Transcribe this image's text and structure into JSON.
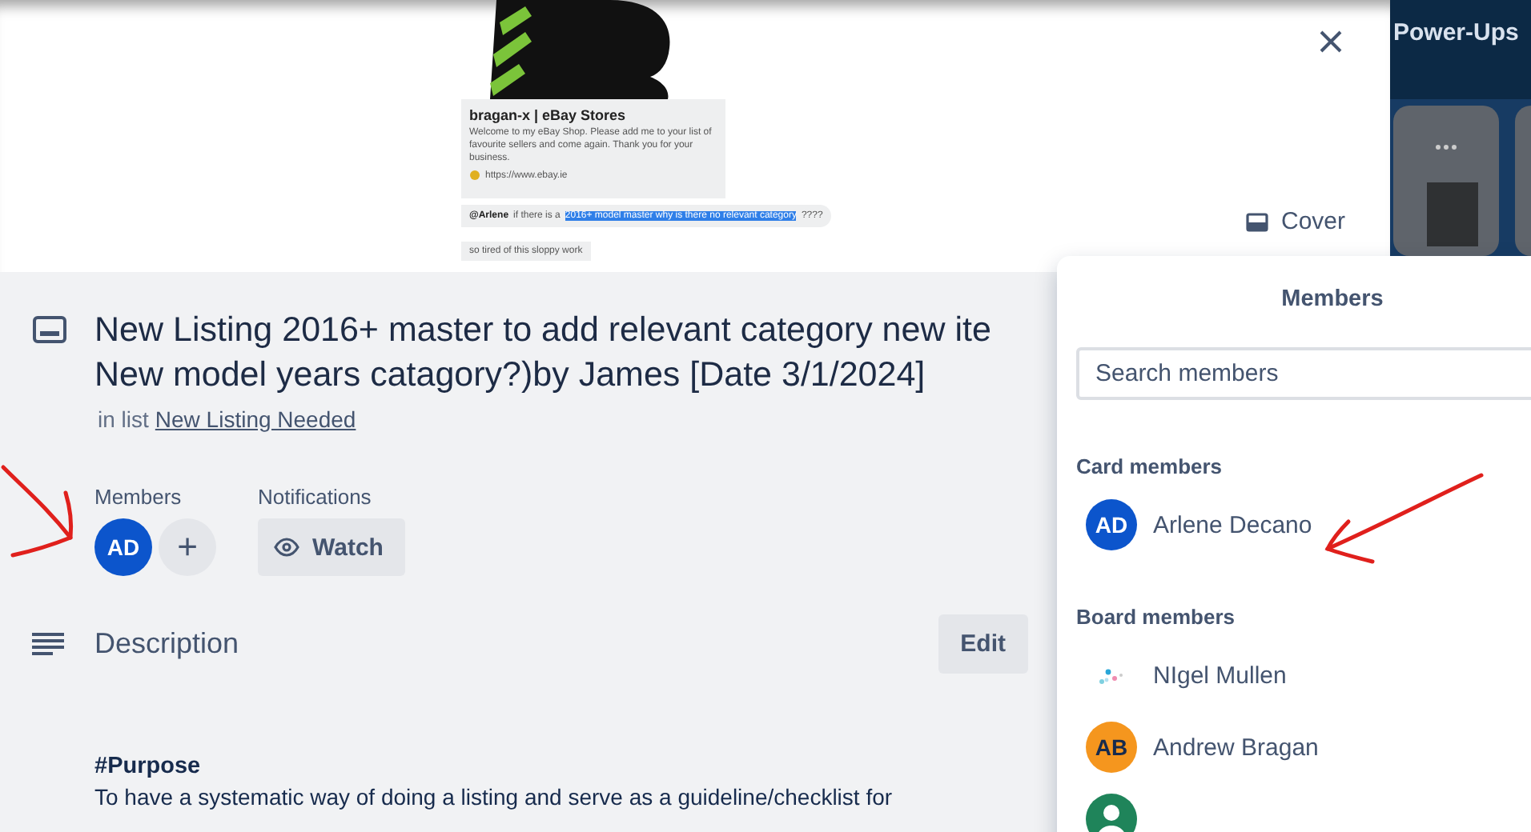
{
  "board": {
    "header_title": "Power-Ups"
  },
  "cover": {
    "store_title": "bragan-x | eBay Stores",
    "store_text": "Welcome to my eBay Shop. Please add me to your list of favourite sellers and come again. Thank you for your business.",
    "store_link": "https://www.ebay.ie",
    "message_mention": "@Arlene",
    "message_before": "if there is a",
    "message_selected": "2016+ model master why is there no relevant category",
    "message_after": "????",
    "message_2": "so tired of this sloppy work",
    "cover_button": "Cover"
  },
  "card": {
    "title_lines": [
      "New Listing 2016+ master to add relevant category new ite",
      "New model years catagory?)by James [Date 3/1/2024]"
    ],
    "list_prefix": "in list",
    "list_name": "New Listing Needed",
    "members_label": "Members",
    "members": [
      {
        "initials": "AD",
        "color": "#0c55cc"
      }
    ],
    "add_member": "+",
    "notifications_label": "Notifications",
    "watch_button": "Watch",
    "description_heading": "Description",
    "edit_button": "Edit",
    "description_title": "#Purpose",
    "description_text": "To have a systematic way of doing a listing and serve as a guideline/checklist for"
  },
  "members_popover": {
    "title": "Members",
    "search_placeholder": "Search members",
    "sections": [
      {
        "heading": "Card members",
        "members": [
          {
            "kind": "initials",
            "name": "Arlene Decano",
            "initials": "AD",
            "color": "#0c55cc"
          }
        ]
      },
      {
        "heading": "Board members",
        "members": [
          {
            "kind": "pattern",
            "name": "NIgel Mullen"
          },
          {
            "kind": "initials",
            "name": "Andrew Bragan",
            "initials": "AB",
            "color": "#f5961e"
          },
          {
            "kind": "silhouette",
            "color": "#1f845a"
          }
        ]
      }
    ]
  }
}
